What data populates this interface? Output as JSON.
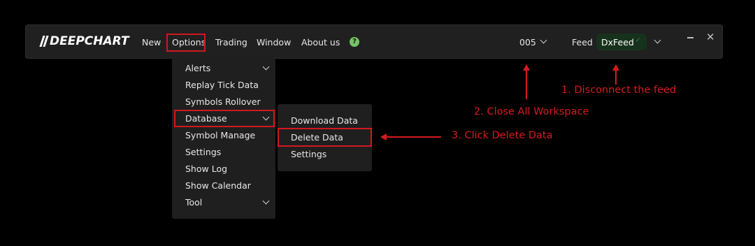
{
  "app": {
    "logo_text": "DEEPCHART"
  },
  "menu": {
    "new": "New",
    "options": "Options",
    "trading": "Trading",
    "window": "Window",
    "about": "About us"
  },
  "workspace": {
    "value": "005"
  },
  "feed": {
    "label": "Feed",
    "value": "DxFeed",
    "status": "✓"
  },
  "window_controls": {
    "close": "✕"
  },
  "options_menu": {
    "items": [
      "Alerts",
      "Replay Tick Data",
      "Symbols Rollover",
      "Database",
      "Symbol Manage",
      "Settings",
      "Show Log",
      "Show Calendar",
      "Tool"
    ]
  },
  "database_submenu": {
    "items": [
      "Download Data",
      "Delete Data",
      "Settings"
    ]
  },
  "annotations": {
    "step1": "1. Disconnect the feed",
    "step2": "2. Close All Workspace",
    "step3": "3. Click Delete Data"
  },
  "colors": {
    "background": "#000000",
    "toolbar": "#202020",
    "menu": "#1f1f1f",
    "accent_red": "#d41c1c",
    "feed_pill": "#17321c",
    "help": "#74c365"
  },
  "icons": {
    "help": "question-circle-icon",
    "chevron": "chevron-down-icon",
    "submenu_arrow": "chevron-down-icon",
    "minimize": "minimize-icon",
    "close": "close-icon"
  }
}
